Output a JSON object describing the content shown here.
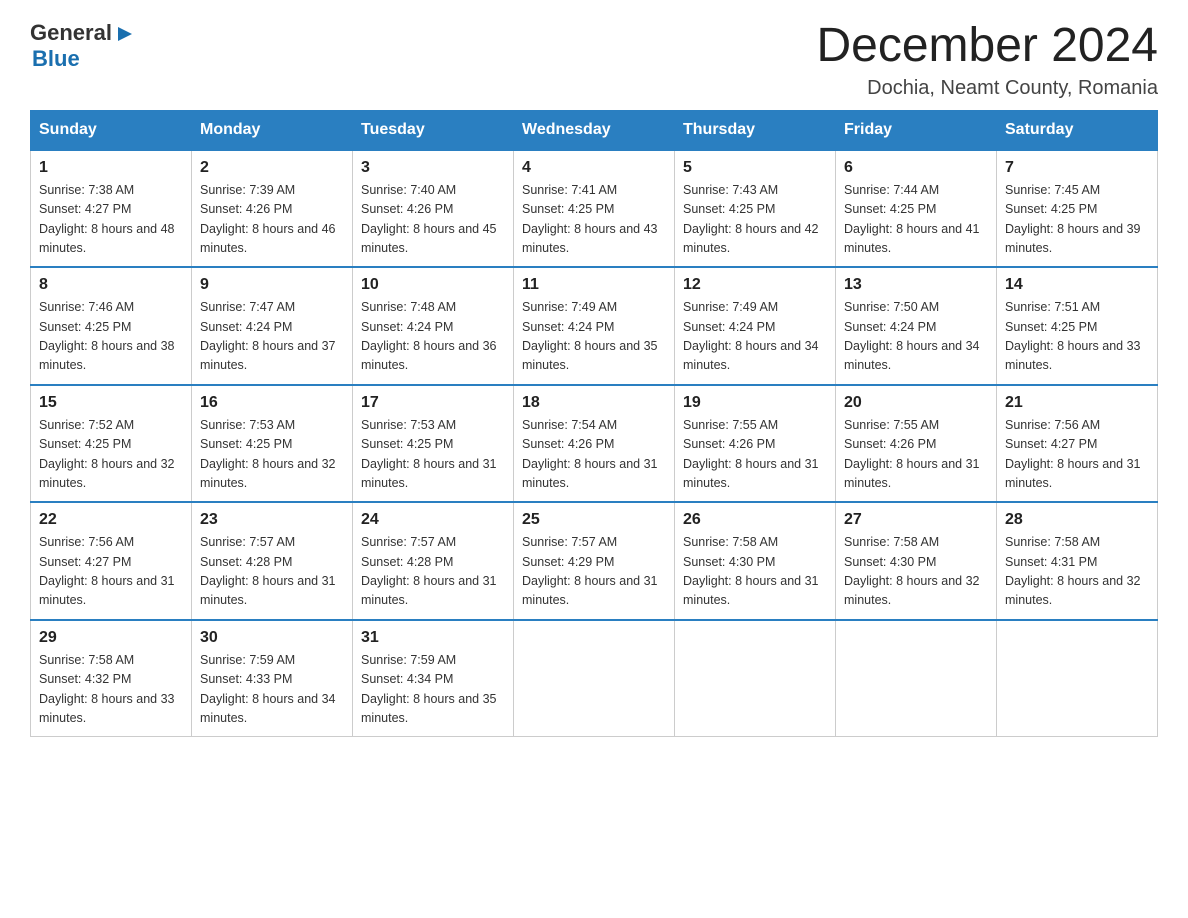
{
  "header": {
    "logo_general": "General",
    "logo_blue": "Blue",
    "month_title": "December 2024",
    "location": "Dochia, Neamt County, Romania"
  },
  "days_of_week": [
    "Sunday",
    "Monday",
    "Tuesday",
    "Wednesday",
    "Thursday",
    "Friday",
    "Saturday"
  ],
  "weeks": [
    [
      {
        "day": "1",
        "sunrise": "7:38 AM",
        "sunset": "4:27 PM",
        "daylight": "8 hours and 48 minutes."
      },
      {
        "day": "2",
        "sunrise": "7:39 AM",
        "sunset": "4:26 PM",
        "daylight": "8 hours and 46 minutes."
      },
      {
        "day": "3",
        "sunrise": "7:40 AM",
        "sunset": "4:26 PM",
        "daylight": "8 hours and 45 minutes."
      },
      {
        "day": "4",
        "sunrise": "7:41 AM",
        "sunset": "4:25 PM",
        "daylight": "8 hours and 43 minutes."
      },
      {
        "day": "5",
        "sunrise": "7:43 AM",
        "sunset": "4:25 PM",
        "daylight": "8 hours and 42 minutes."
      },
      {
        "day": "6",
        "sunrise": "7:44 AM",
        "sunset": "4:25 PM",
        "daylight": "8 hours and 41 minutes."
      },
      {
        "day": "7",
        "sunrise": "7:45 AM",
        "sunset": "4:25 PM",
        "daylight": "8 hours and 39 minutes."
      }
    ],
    [
      {
        "day": "8",
        "sunrise": "7:46 AM",
        "sunset": "4:25 PM",
        "daylight": "8 hours and 38 minutes."
      },
      {
        "day": "9",
        "sunrise": "7:47 AM",
        "sunset": "4:24 PM",
        "daylight": "8 hours and 37 minutes."
      },
      {
        "day": "10",
        "sunrise": "7:48 AM",
        "sunset": "4:24 PM",
        "daylight": "8 hours and 36 minutes."
      },
      {
        "day": "11",
        "sunrise": "7:49 AM",
        "sunset": "4:24 PM",
        "daylight": "8 hours and 35 minutes."
      },
      {
        "day": "12",
        "sunrise": "7:49 AM",
        "sunset": "4:24 PM",
        "daylight": "8 hours and 34 minutes."
      },
      {
        "day": "13",
        "sunrise": "7:50 AM",
        "sunset": "4:24 PM",
        "daylight": "8 hours and 34 minutes."
      },
      {
        "day": "14",
        "sunrise": "7:51 AM",
        "sunset": "4:25 PM",
        "daylight": "8 hours and 33 minutes."
      }
    ],
    [
      {
        "day": "15",
        "sunrise": "7:52 AM",
        "sunset": "4:25 PM",
        "daylight": "8 hours and 32 minutes."
      },
      {
        "day": "16",
        "sunrise": "7:53 AM",
        "sunset": "4:25 PM",
        "daylight": "8 hours and 32 minutes."
      },
      {
        "day": "17",
        "sunrise": "7:53 AM",
        "sunset": "4:25 PM",
        "daylight": "8 hours and 31 minutes."
      },
      {
        "day": "18",
        "sunrise": "7:54 AM",
        "sunset": "4:26 PM",
        "daylight": "8 hours and 31 minutes."
      },
      {
        "day": "19",
        "sunrise": "7:55 AM",
        "sunset": "4:26 PM",
        "daylight": "8 hours and 31 minutes."
      },
      {
        "day": "20",
        "sunrise": "7:55 AM",
        "sunset": "4:26 PM",
        "daylight": "8 hours and 31 minutes."
      },
      {
        "day": "21",
        "sunrise": "7:56 AM",
        "sunset": "4:27 PM",
        "daylight": "8 hours and 31 minutes."
      }
    ],
    [
      {
        "day": "22",
        "sunrise": "7:56 AM",
        "sunset": "4:27 PM",
        "daylight": "8 hours and 31 minutes."
      },
      {
        "day": "23",
        "sunrise": "7:57 AM",
        "sunset": "4:28 PM",
        "daylight": "8 hours and 31 minutes."
      },
      {
        "day": "24",
        "sunrise": "7:57 AM",
        "sunset": "4:28 PM",
        "daylight": "8 hours and 31 minutes."
      },
      {
        "day": "25",
        "sunrise": "7:57 AM",
        "sunset": "4:29 PM",
        "daylight": "8 hours and 31 minutes."
      },
      {
        "day": "26",
        "sunrise": "7:58 AM",
        "sunset": "4:30 PM",
        "daylight": "8 hours and 31 minutes."
      },
      {
        "day": "27",
        "sunrise": "7:58 AM",
        "sunset": "4:30 PM",
        "daylight": "8 hours and 32 minutes."
      },
      {
        "day": "28",
        "sunrise": "7:58 AM",
        "sunset": "4:31 PM",
        "daylight": "8 hours and 32 minutes."
      }
    ],
    [
      {
        "day": "29",
        "sunrise": "7:58 AM",
        "sunset": "4:32 PM",
        "daylight": "8 hours and 33 minutes."
      },
      {
        "day": "30",
        "sunrise": "7:59 AM",
        "sunset": "4:33 PM",
        "daylight": "8 hours and 34 minutes."
      },
      {
        "day": "31",
        "sunrise": "7:59 AM",
        "sunset": "4:34 PM",
        "daylight": "8 hours and 35 minutes."
      },
      null,
      null,
      null,
      null
    ]
  ]
}
